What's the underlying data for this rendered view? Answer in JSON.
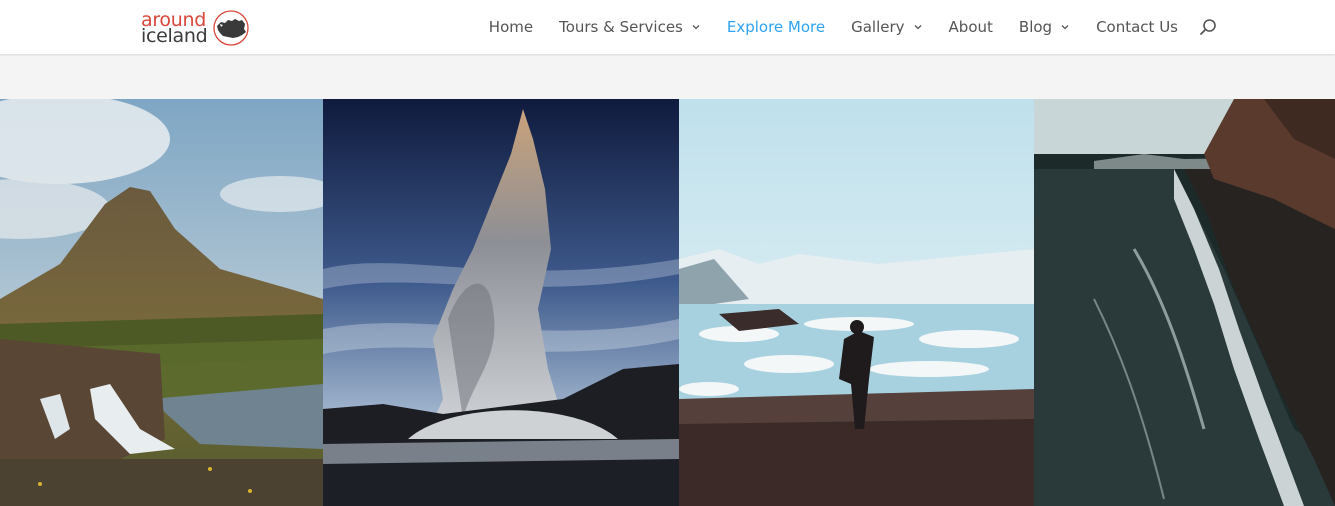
{
  "logo": {
    "line1": "around",
    "line2": "iceland",
    "mark_icon": "iceland-map-icon",
    "line1_color": "#d9463a",
    "line2_color": "#3b3b3b"
  },
  "nav": {
    "items": [
      {
        "label": "Home",
        "has_dropdown": false,
        "active": false
      },
      {
        "label": "Tours & Services",
        "has_dropdown": true,
        "active": false
      },
      {
        "label": "Explore More",
        "has_dropdown": false,
        "active": true
      },
      {
        "label": "Gallery",
        "has_dropdown": true,
        "active": false
      },
      {
        "label": "About",
        "has_dropdown": false,
        "active": false
      },
      {
        "label": "Blog",
        "has_dropdown": true,
        "active": false
      },
      {
        "label": "Contact Us",
        "has_dropdown": false,
        "active": false
      }
    ],
    "active_color": "#2ea3f2",
    "text_color": "#555555",
    "search_icon": "search-icon"
  },
  "gallery": {
    "images": [
      {
        "name": "mountain-waterfall-photo"
      },
      {
        "name": "geyser-eruption-photo"
      },
      {
        "name": "glacier-lagoon-photo"
      },
      {
        "name": "black-sand-beach-photo"
      }
    ]
  }
}
